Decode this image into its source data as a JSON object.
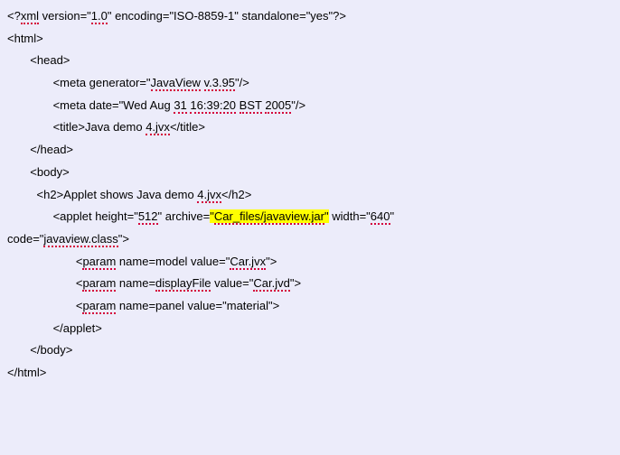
{
  "l1_a": "<?",
  "l1_b": "xml",
  "l1_c": " version=\"",
  "l1_d": "1.0",
  "l1_e": "\" encoding=\"ISO-8859-1\" standalone=\"yes\"?>",
  "l2": "<html>",
  "l3": "       <head>",
  "l4_a": "              <meta generator=\"",
  "l4_b": "JavaView",
  "l4_c": " ",
  "l4_d": "v.3.95",
  "l4_e": "\"/>",
  "l5_a": "              <meta date=\"Wed Aug ",
  "l5_b": "31",
  "l5_c": " ",
  "l5_d": "16:39:20",
  "l5_e": " ",
  "l5_f": "BST",
  "l5_g": " ",
  "l5_h": "2005",
  "l5_i": "\"/>",
  "l6_a": "              <title>Java demo ",
  "l6_b": "4.jvx",
  "l6_c": "</title>",
  "l7": "       </head>",
  "l8": "       <body>",
  "l9_a": "         <h2>Applet shows Java demo ",
  "l9_b": "4.jvx",
  "l9_c": "</h2>",
  "l10_a": "              <applet height=\"",
  "l10_b": "512",
  "l10_c": "\" archive=",
  "l10_d": "\"",
  "l10_e": "Car_files/javaview.jar",
  "l10_f": "\"",
  "l10_g": " width=\"",
  "l10_h": "640",
  "l10_i": "\"",
  "l11_a": "code=\"",
  "l11_b": "javaview.class",
  "l11_c": "\">",
  "l12_a": "                     <",
  "l12_b": "param",
  "l12_c": " name=model value=\"",
  "l12_d": "Car.jvx",
  "l12_e": "\">",
  "l13_a": "                     <",
  "l13_b": "param",
  "l13_c": " name=",
  "l13_d": "displayFile",
  "l13_e": " value=\"",
  "l13_f": "Car.jvd",
  "l13_g": "\">",
  "l14_a": "                     <",
  "l14_b": "param",
  "l14_c": " name=panel value=\"material\">",
  "l15": "              </applet>",
  "l16": "       </body>",
  "l17": "</html>"
}
